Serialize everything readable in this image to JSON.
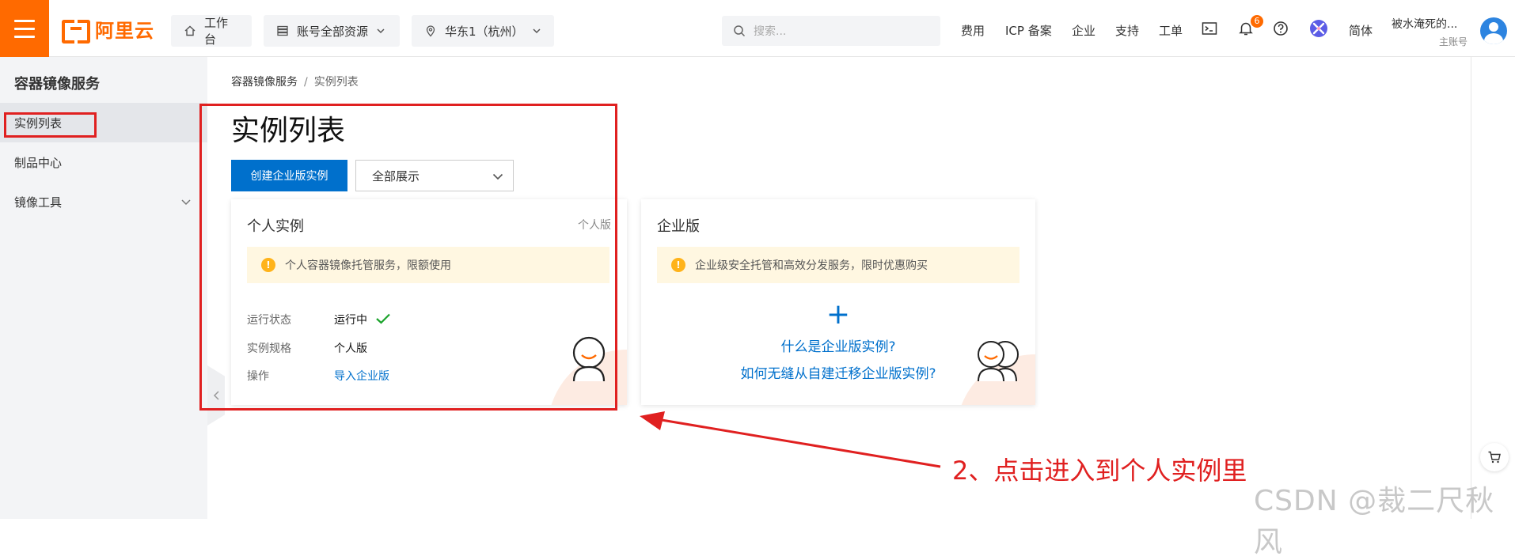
{
  "topbar": {
    "logo_text": "阿里云",
    "workbench": "工作台",
    "resources": "账号全部资源",
    "region": "华东1（杭州）",
    "search_placeholder": "搜索...",
    "links": [
      "费用",
      "ICP 备案",
      "企业",
      "支持",
      "工单"
    ],
    "notification_count": "6",
    "language": "简体",
    "user_name": "被水淹死的...",
    "user_role": "主账号"
  },
  "sidebar": {
    "title": "容器镜像服务",
    "items": [
      {
        "label": "实例列表"
      },
      {
        "label": "制品中心"
      },
      {
        "label": "镜像工具"
      }
    ]
  },
  "breadcrumb": {
    "root": "容器镜像服务",
    "sep": "/",
    "current": "实例列表"
  },
  "page": {
    "title": "实例列表",
    "create_button": "创建企业版实例",
    "filter_value": "全部展示"
  },
  "personal_card": {
    "title": "个人实例",
    "tag": "个人版",
    "notice": "个人容器镜像托管服务，限额使用",
    "rows": [
      {
        "key": "运行状态",
        "value": "运行中"
      },
      {
        "key": "实例规格",
        "value": "个人版"
      },
      {
        "key": "操作",
        "value": "导入企业版"
      }
    ]
  },
  "enterprise_card": {
    "title": "企业版",
    "notice": "企业级安全托管和高效分发服务，限时优惠购买",
    "plus": "+",
    "link1": "什么是企业版实例?",
    "link2": "如何无缝从自建迁移企业版实例?"
  },
  "annotation": {
    "text": "2、点击进入到个人实例里",
    "color": "#e02020"
  },
  "watermark": "CSDN @裁二尺秋风",
  "colors": {
    "brand": "#ff6a00",
    "primary": "#0070cc",
    "success": "#1aa32b",
    "warn": "#ffb31a"
  }
}
